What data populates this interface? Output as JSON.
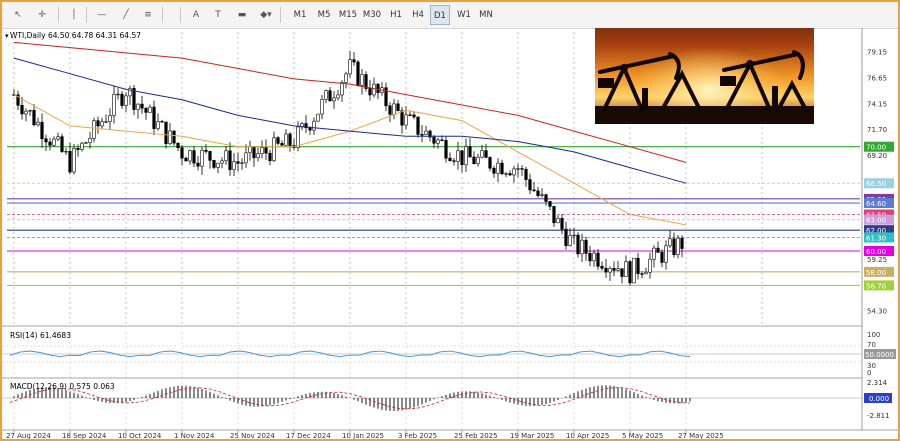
{
  "toolbar": {
    "tools": [
      {
        "name": "cursor-icon",
        "glyph": "↖"
      },
      {
        "name": "crosshair-icon",
        "glyph": "✛"
      },
      {
        "name": "vertical-line-icon",
        "glyph": "│"
      },
      {
        "name": "horizontal-line-icon",
        "glyph": "—"
      },
      {
        "name": "trendline-icon",
        "glyph": "╱"
      },
      {
        "name": "fibonacci-icon",
        "glyph": "≡"
      },
      {
        "name": "text-icon",
        "glyph": "A"
      },
      {
        "name": "text-label-icon",
        "glyph": "T"
      },
      {
        "name": "rectangle-icon",
        "glyph": "▬"
      },
      {
        "name": "shapes-menu-icon",
        "glyph": "◆▾"
      }
    ],
    "timeframes": [
      "M1",
      "M5",
      "M15",
      "M30",
      "H1",
      "H4",
      "D1",
      "W1",
      "MN"
    ],
    "active_timeframe": "D1"
  },
  "chart_title": "WTI,Daily  64.50 64.78 64.31 64.57",
  "price_axis": [
    "79.15",
    "76.65",
    "74.15",
    "71.70",
    "69.20",
    "59.25",
    "54.30"
  ],
  "levels": [
    {
      "label": "70.00",
      "value": 70.0,
      "color": "#2eaa2e",
      "style": "solid"
    },
    {
      "label": "66.50",
      "value": 66.5,
      "color": "#9ad0e0",
      "style": "dashed"
    },
    {
      "label": "65.00",
      "value": 65.0,
      "color": "#7b3fa0",
      "style": "solid"
    },
    {
      "label": "64.60",
      "value": 64.6,
      "color": "#5b7bd5",
      "style": "solid"
    },
    {
      "label": "63.50",
      "value": 63.5,
      "color": "#e0407a",
      "style": "dashed"
    },
    {
      "label": "63.00",
      "value": 63.0,
      "color": "#c9a0dc",
      "style": "dashed"
    },
    {
      "label": "62.00",
      "value": 62.0,
      "color": "#2b3f8c",
      "style": "solid"
    },
    {
      "label": "61.30",
      "value": 61.3,
      "color": "#2ec0c0",
      "style": "dashed"
    },
    {
      "label": "60.00",
      "value": 60.0,
      "color": "#e000e0",
      "style": "solid"
    },
    {
      "label": "58.00",
      "value": 58.0,
      "color": "#c8b060",
      "style": "solid"
    },
    {
      "label": "56.70",
      "value": 56.7,
      "color": "#a0d040",
      "style": "solid"
    }
  ],
  "rsi": {
    "label": "RSI(14) 61.4683",
    "axis": [
      "100",
      "70",
      "30",
      "0"
    ],
    "level_label": "50.0000",
    "value": 61.4683
  },
  "macd": {
    "label": "MACD(12,26,9) 0.575 0.063",
    "axis": [
      "2.314",
      "-2.811"
    ],
    "level_label": "0.000"
  },
  "dates": [
    "27 Aug 2024",
    "18 Sep 2024",
    "10 Oct 2024",
    "1 Nov 2024",
    "25 Nov 2024",
    "17 Dec 2024",
    "10 Jan 2025",
    "3 Feb 2025",
    "25 Feb 2025",
    "19 Mar 2025",
    "10 Apr 2025",
    "5 May 2025",
    "27 May 2025"
  ],
  "colors": {
    "frame": "#e8a040",
    "ma_fast": "#e8a848",
    "ma_mid": "#1a2a8c",
    "ma_slow": "#cc2222",
    "rsi_line": "#3b8fd6",
    "macd_signal": "#cc2222"
  },
  "chart_data": {
    "type": "candlestick",
    "title": "WTI,Daily",
    "ohlc_last": {
      "open": 64.5,
      "high": 64.78,
      "low": 64.31,
      "close": 64.57
    },
    "x": [
      "27 Aug 2024",
      "18 Sep 2024",
      "10 Oct 2024",
      "1 Nov 2024",
      "25 Nov 2024",
      "17 Dec 2024",
      "10 Jan 2025",
      "3 Feb 2025",
      "25 Feb 2025",
      "19 Mar 2025",
      "10 Apr 2025",
      "5 May 2025",
      "27 May 2025"
    ],
    "close": [
      75.0,
      68.5,
      75.5,
      69.5,
      68.5,
      70.5,
      77.5,
      72.5,
      69.0,
      68.0,
      60.5,
      58.0,
      61.0
    ],
    "series": [
      {
        "name": "fast",
        "values": [
          75.0,
          72.0,
          71.5,
          71.0,
          70.0,
          70.0,
          71.5,
          73.5,
          72.5,
          69.5,
          66.5,
          63.5,
          62.5
        ]
      },
      {
        "name": "mid",
        "values": [
          78.5,
          77.0,
          75.5,
          74.5,
          73.0,
          72.0,
          71.5,
          71.0,
          71.0,
          70.5,
          69.5,
          68.0,
          66.5
        ]
      },
      {
        "name": "slow",
        "values": [
          80.0,
          79.5,
          79.0,
          78.5,
          77.5,
          76.5,
          76.0,
          75.0,
          74.0,
          73.0,
          71.5,
          70.0,
          68.5
        ]
      }
    ],
    "yrange": [
      53.0,
      81.0
    ]
  }
}
